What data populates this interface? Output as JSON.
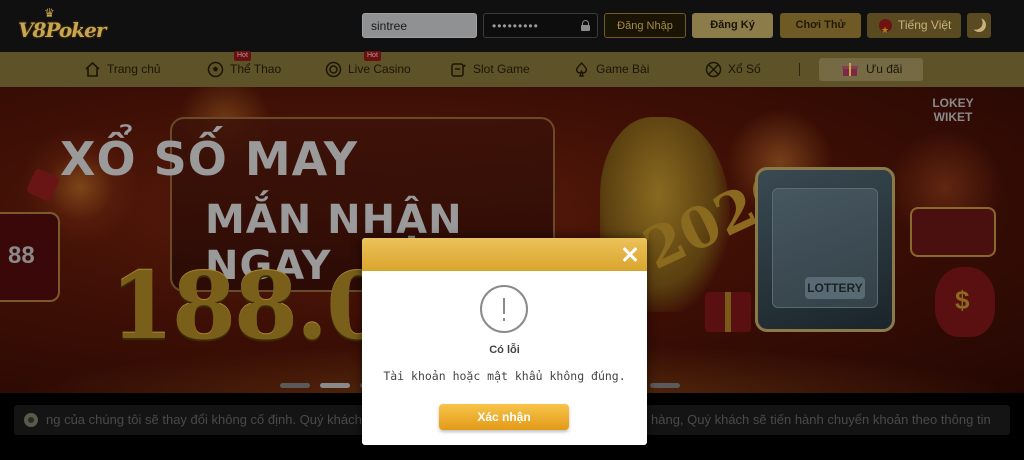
{
  "header": {
    "logo_text": "V8Poker",
    "username_value": "sintree",
    "password_value": "•••••••••",
    "login_label": "Đăng Nhập",
    "register_label": "Đăng Ký",
    "trial_label": "Chơi Thử",
    "language_label": "Tiếng Việt",
    "theme_icon": "moon-icon"
  },
  "nav": {
    "items": [
      {
        "label": "Trang chủ",
        "icon": "home-icon",
        "hot": false
      },
      {
        "label": "Thể Thao",
        "icon": "soccer-ball-icon",
        "hot": true,
        "badge": "Hot"
      },
      {
        "label": "Live Casino",
        "icon": "casino-chip-icon",
        "hot": true,
        "badge": "Hot"
      },
      {
        "label": "Slot Game",
        "icon": "slot-machine-icon",
        "hot": false
      },
      {
        "label": "Game Bài",
        "icon": "spade-icon",
        "hot": false
      },
      {
        "label": "Xổ Số",
        "icon": "lottery-ball-icon",
        "hot": false
      }
    ],
    "promo_label": "Ưu đãi"
  },
  "banner": {
    "title_line1": "XỔ SỐ MAY",
    "title_line2": "MẮN NHẬN NGAY",
    "amount": "188.0",
    "year": "2026",
    "sign_line1": "LOKEY",
    "sign_line2": "WIKET",
    "machine_label": "LOTTERY",
    "left_box_text": "88",
    "slides": 4,
    "active_slide": 2
  },
  "marquee": {
    "text_left": "ng của chúng tôi sẽ thay đổi không cố định. Quý khách",
    "text_right": "hàng, Quý khách sẽ tiến hành chuyển khoản theo thông tin"
  },
  "modal": {
    "title": "Có lỗi",
    "message": "Tài khoản hoặc mật khẩu không đúng.",
    "confirm_label": "Xác nhận"
  },
  "colors": {
    "header_bg": "#101010",
    "nav_bg": "#5e5229",
    "modal_header": "#e3b443",
    "confirm_button": "#f0b030"
  }
}
